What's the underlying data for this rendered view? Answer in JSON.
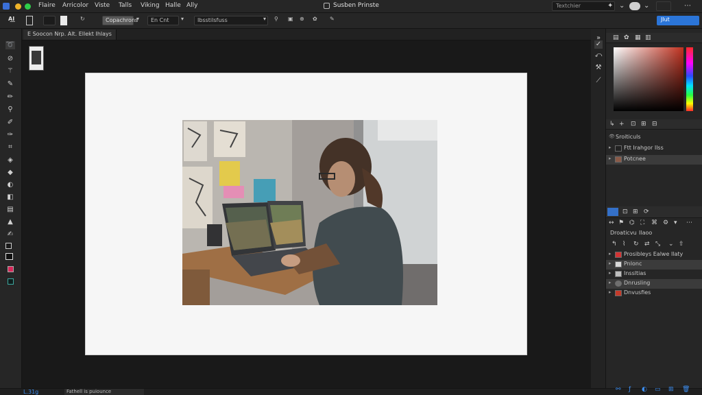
{
  "app": {
    "menu": [
      "Flaire",
      "Arricolor",
      "Viste",
      "Talls",
      "Viking",
      "Halle",
      "Ally"
    ],
    "title": "Susben Prinste",
    "search_placeholder": "Textchier",
    "accent": "#2b75d8"
  },
  "options": {
    "select1": "Copachrons",
    "field": "En Cnt",
    "style": "Ibsstilsfuss",
    "primary": "Jlut"
  },
  "document": {
    "tab_label": "E Soocon  Nrp. Alt. Ellekt Ihlays"
  },
  "layers_panel": {
    "group_title": "Sroiticuls",
    "rows": [
      {
        "label": "Ftt Irahgor Ilss",
        "selected": false
      },
      {
        "label": "Potcnee",
        "selected": true
      }
    ]
  },
  "properties_panel": {
    "header": [
      "Droaticvu",
      "Ilaoo"
    ],
    "rows": [
      {
        "label": "Prosibleys  Ealwe Ilaty"
      },
      {
        "label": "Pnlonc"
      },
      {
        "label": "Inssltias"
      },
      {
        "label": "Dnrusling"
      },
      {
        "label": "Dnvusfies"
      }
    ]
  },
  "status": {
    "zoom": "L.31g",
    "info": "Fathell is puiounce"
  },
  "icons": [
    "apple-logo-icon",
    "dropdown-icon",
    "search-icon",
    "refresh-icon",
    "window-icon",
    "more-icon",
    "brush-icon",
    "eyedropper-icon",
    "lasso-icon",
    "move-icon",
    "crop-icon",
    "stamp-icon",
    "eraser-icon",
    "bucket-icon",
    "text-icon",
    "shape-icon",
    "zoom-icon",
    "hand-icon",
    "layers-icon",
    "adjust-icon",
    "add-layer-icon",
    "trash-icon"
  ]
}
